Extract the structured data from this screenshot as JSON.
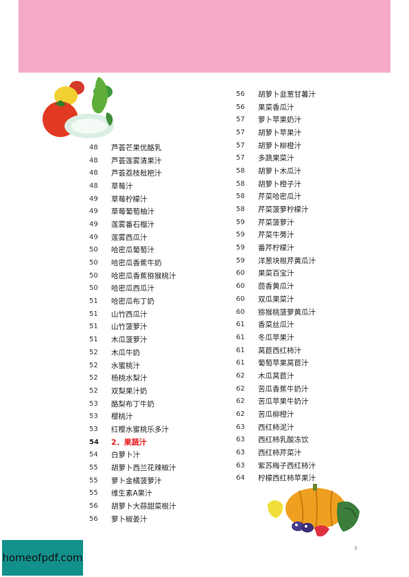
{
  "watermark": "homeofpdf.com",
  "folio": "3",
  "left_column": [
    {
      "page": "48",
      "title": "芦荟芒果优酪乳"
    },
    {
      "page": "48",
      "title": "芦荟莲雾清果汁"
    },
    {
      "page": "48",
      "title": "芦荟荔枝枇杷汁"
    },
    {
      "page": "48",
      "title": "草莓汁"
    },
    {
      "page": "49",
      "title": "草莓柠檬汁"
    },
    {
      "page": "49",
      "title": "草莓葡萄柚汁"
    },
    {
      "page": "49",
      "title": "莲雾番石榴汁"
    },
    {
      "page": "49",
      "title": "莲雾西瓜汁"
    },
    {
      "page": "50",
      "title": "哈密瓜葡萄汁"
    },
    {
      "page": "50",
      "title": "哈密瓜香蕉牛奶"
    },
    {
      "page": "50",
      "title": "哈密瓜香蕉猕猴桃汁"
    },
    {
      "page": "50",
      "title": "哈密瓜西瓜汁"
    },
    {
      "page": "51",
      "title": "哈密瓜布丁奶"
    },
    {
      "page": "51",
      "title": "山竹西瓜汁"
    },
    {
      "page": "51",
      "title": "山竹菠萝汁"
    },
    {
      "page": "51",
      "title": "木瓜菠萝汁"
    },
    {
      "page": "52",
      "title": "木瓜牛奶"
    },
    {
      "page": "52",
      "title": "水蜜桃汁"
    },
    {
      "page": "52",
      "title": "杨桃水梨汁"
    },
    {
      "page": "52",
      "title": "双梨果汁奶"
    },
    {
      "page": "53",
      "title": "酪梨布丁牛奶"
    },
    {
      "page": "53",
      "title": "樱桃汁"
    },
    {
      "page": "53",
      "title": "红樱水蜜桃乐多汁"
    },
    {
      "page": "54",
      "title": "2．果蔬汁",
      "section": true
    },
    {
      "page": "54",
      "title": "白萝卜汁"
    },
    {
      "page": "55",
      "title": "胡萝卜西兰花辣椒汁"
    },
    {
      "page": "55",
      "title": "萝卜金橘菠萝汁"
    },
    {
      "page": "55",
      "title": "维生素A果汁"
    },
    {
      "page": "56",
      "title": "胡萝卜大蒜甜菜根汁"
    },
    {
      "page": "56",
      "title": "萝卜椒姜汁"
    }
  ],
  "right_column": [
    {
      "page": "56",
      "title": "胡萝卜韭葱甘薯汁"
    },
    {
      "page": "56",
      "title": "果菜香瓜汁"
    },
    {
      "page": "57",
      "title": "萝卜苹果奶汁"
    },
    {
      "page": "57",
      "title": "胡萝卜苹果汁"
    },
    {
      "page": "57",
      "title": "胡萝卜柳橙汁"
    },
    {
      "page": "57",
      "title": "多蔬果菜汁"
    },
    {
      "page": "58",
      "title": "胡萝卜木瓜汁"
    },
    {
      "page": "58",
      "title": "胡萝卜橙子汁"
    },
    {
      "page": "58",
      "title": "芹菜哈密瓜汁"
    },
    {
      "page": "58",
      "title": "芹菜菠萝柠檬汁"
    },
    {
      "page": "59",
      "title": "芹菜菠萝汁"
    },
    {
      "page": "59",
      "title": "芹菜牛蒡汁"
    },
    {
      "page": "59",
      "title": "番芹柠檬汁"
    },
    {
      "page": "59",
      "title": "洋葱块根芹黄瓜汁"
    },
    {
      "page": "60",
      "title": "果菜百宝汁"
    },
    {
      "page": "60",
      "title": "茴香黄瓜汁"
    },
    {
      "page": "60",
      "title": "双瓜果菜汁"
    },
    {
      "page": "60",
      "title": "猕猴桃菠萝黄瓜汁"
    },
    {
      "page": "61",
      "title": "香菜丝瓜汁"
    },
    {
      "page": "61",
      "title": "冬瓜苹果汁"
    },
    {
      "page": "61",
      "title": "莴苣西红柿汁"
    },
    {
      "page": "61",
      "title": "葡萄苹果莴苣汁"
    },
    {
      "page": "62",
      "title": "木瓜莴苣汁"
    },
    {
      "page": "62",
      "title": "苦瓜香蕉牛奶汁"
    },
    {
      "page": "62",
      "title": "苦瓜苹果牛奶汁"
    },
    {
      "page": "62",
      "title": "苦瓜柳橙汁"
    },
    {
      "page": "63",
      "title": "西红柿泥汁"
    },
    {
      "page": "63",
      "title": "西红柿乳酸冻饮"
    },
    {
      "page": "63",
      "title": "西红柿芹菜汁"
    },
    {
      "page": "63",
      "title": "紫苏梅子西红柿汁"
    },
    {
      "page": "64",
      "title": "柠檬西红柿苹果汁"
    }
  ]
}
